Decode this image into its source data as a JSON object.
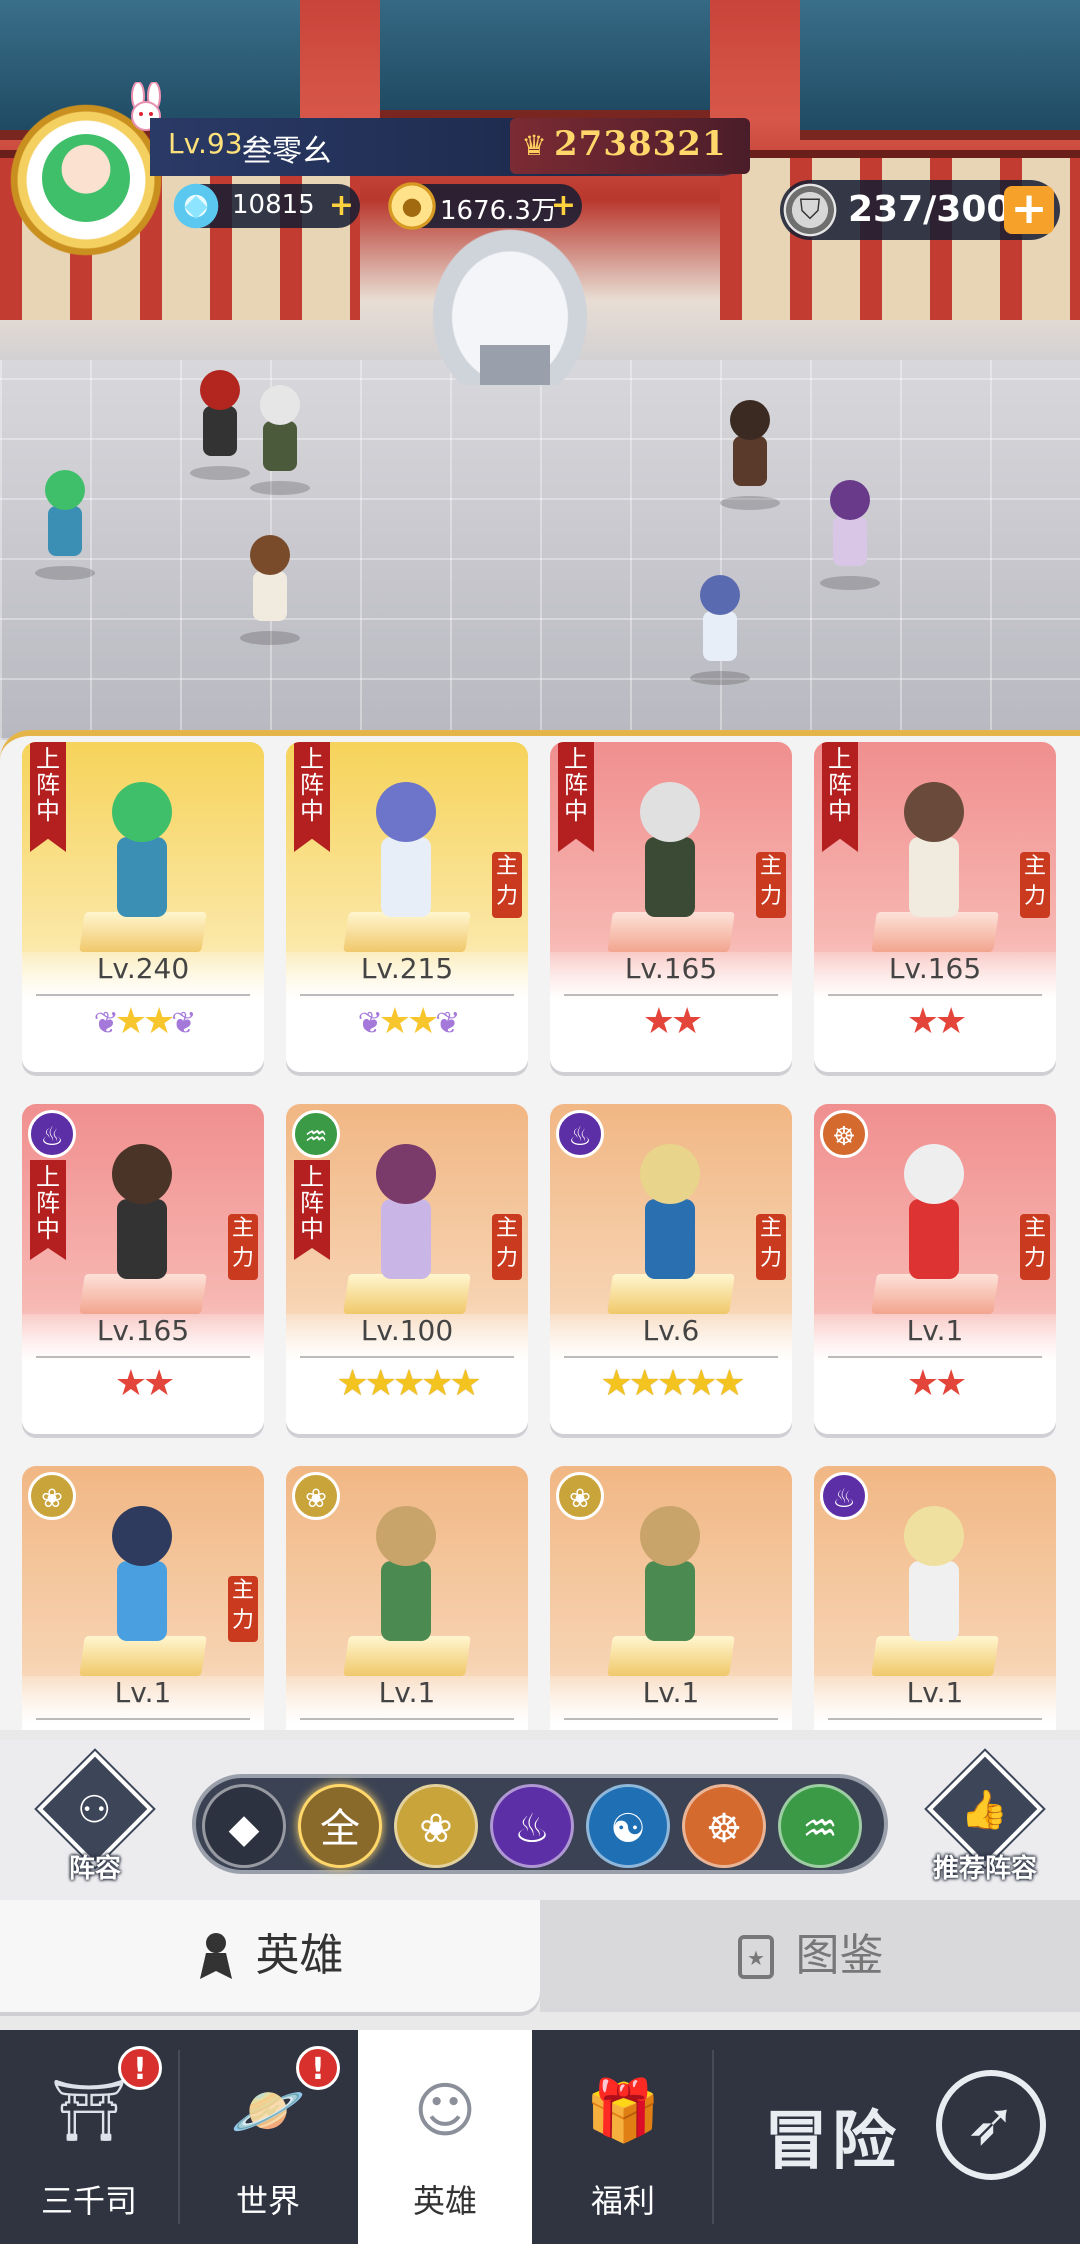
{
  "player": {
    "level": "Lv.93",
    "name": "叁零幺",
    "power": "2738321",
    "gems": "10815",
    "gold": "1676.3万",
    "stamina": "237/300"
  },
  "heroes": [
    {
      "level": "Lv.240",
      "stars": "★★",
      "star_style": "purple",
      "in_lineup": true,
      "main": false,
      "card": "gold",
      "faction": null
    },
    {
      "level": "Lv.215",
      "stars": "★★",
      "star_style": "purple",
      "in_lineup": true,
      "main": true,
      "card": "gold",
      "faction": null
    },
    {
      "level": "Lv.165",
      "stars": "★★",
      "star_style": "red",
      "in_lineup": true,
      "main": true,
      "card": "red",
      "faction": null
    },
    {
      "level": "Lv.165",
      "stars": "★★",
      "star_style": "red",
      "in_lineup": true,
      "main": true,
      "card": "red",
      "faction": null
    },
    {
      "level": "Lv.165",
      "stars": "★★",
      "star_style": "red",
      "in_lineup": true,
      "main": true,
      "card": "red",
      "faction": "fire"
    },
    {
      "level": "Lv.100",
      "stars": "★★★★★",
      "star_style": "gold",
      "in_lineup": true,
      "main": true,
      "card": "orange",
      "faction": "wood"
    },
    {
      "level": "Lv.6",
      "stars": "★★★★★",
      "star_style": "gold",
      "in_lineup": false,
      "main": true,
      "card": "orange",
      "faction": "fire"
    },
    {
      "level": "Lv.1",
      "stars": "★★",
      "star_style": "red",
      "in_lineup": false,
      "main": true,
      "card": "red",
      "faction": "zen"
    },
    {
      "level": "Lv.1",
      "stars": "★★★★★",
      "star_style": "gold",
      "in_lineup": false,
      "main": true,
      "card": "orange",
      "faction": "lotus"
    },
    {
      "level": "Lv.1",
      "stars": "★★★★★",
      "star_style": "gold",
      "in_lineup": false,
      "main": false,
      "card": "orange",
      "faction": "lotus"
    },
    {
      "level": "Lv.1",
      "stars": "★★★★★",
      "star_style": "gold",
      "in_lineup": false,
      "main": false,
      "card": "orange",
      "faction": "lotus"
    },
    {
      "level": "Lv.1",
      "stars": "★★★★★",
      "star_style": "gold",
      "in_lineup": false,
      "main": false,
      "card": "orange",
      "faction": "fire"
    }
  ],
  "labels": {
    "in_lineup": "上阵中",
    "main": "主力",
    "lineup": "阵容",
    "recommend": "推荐阵容"
  },
  "faction_filters": [
    {
      "glyph": "◆",
      "color": "#2d3240",
      "icon": "diamonds-icon"
    },
    {
      "glyph": "全",
      "color": "#8a6a2a",
      "icon": "all-filter-icon"
    },
    {
      "glyph": "❀",
      "color": "#c9a43b",
      "icon": "lotus-icon"
    },
    {
      "glyph": "♨",
      "color": "#5d2fa6",
      "icon": "purple-flame-icon"
    },
    {
      "glyph": "☯",
      "color": "#1f6fb5",
      "icon": "yin-yang-icon"
    },
    {
      "glyph": "☸",
      "color": "#d46a2e",
      "icon": "meditation-icon"
    },
    {
      "glyph": "♒",
      "color": "#3b9a45",
      "icon": "dna-icon"
    }
  ],
  "tabs": {
    "heroes": "英雄",
    "atlas": "图鉴"
  },
  "nav": {
    "items": [
      {
        "label": "三千司",
        "badge": "!"
      },
      {
        "label": "世界",
        "badge": "!"
      },
      {
        "label": "英雄",
        "badge": ""
      },
      {
        "label": "福利",
        "badge": ""
      }
    ],
    "adventure": "冒险"
  }
}
